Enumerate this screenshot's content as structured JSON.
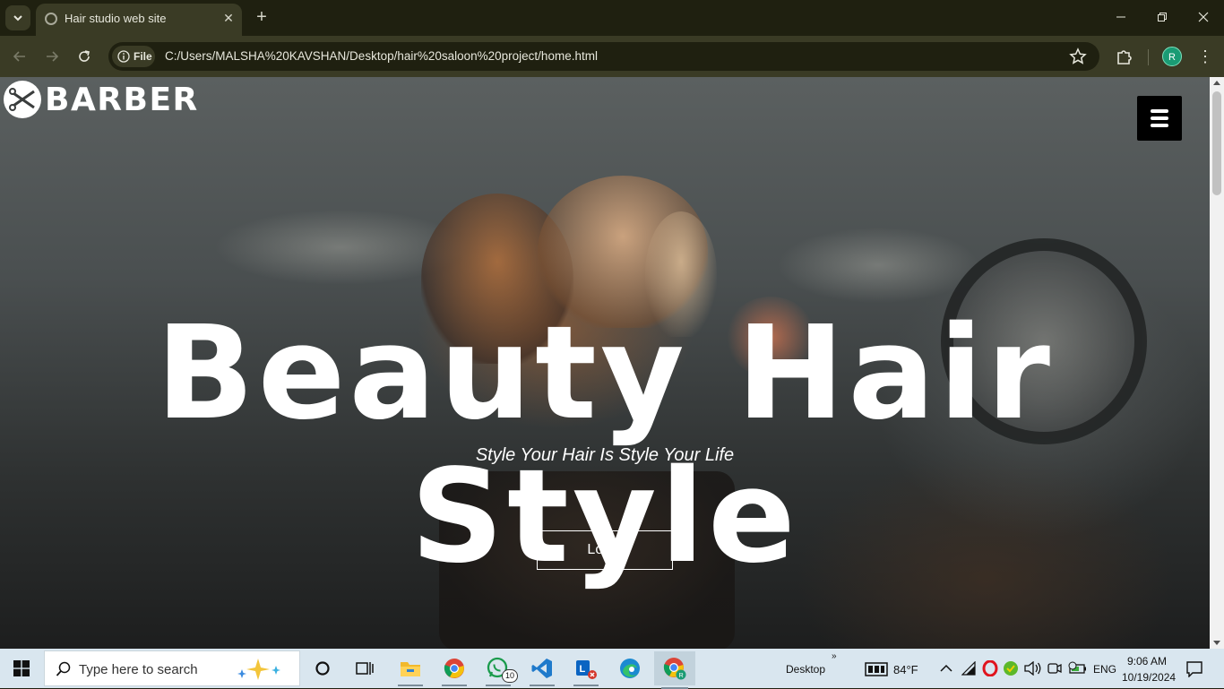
{
  "browser": {
    "tab_title": "Hair studio web site",
    "url_chip": "File",
    "url": "C:/Users/MALSHA%20KAVSHAN/Desktop/hair%20saloon%20project/home.html",
    "avatar_letter": "R"
  },
  "page": {
    "logo_text": "BARBER",
    "hero_title": "Beauty Hair Style",
    "hero_subtitle": "Style Your Hair Is Style Your Life",
    "login_label": "Login"
  },
  "taskbar": {
    "search_placeholder": "Type here to search",
    "whatsapp_badge": "10",
    "desktop_label": "Desktop",
    "weather": "84°F",
    "language": "ENG",
    "time": "9:06 AM",
    "date": "10/19/2024"
  },
  "colors": {
    "title_bar": "#1f2010",
    "toolbar": "#3a3b25",
    "taskbar": "#d9e6ef",
    "profile_avatar": "#1a9b74"
  }
}
